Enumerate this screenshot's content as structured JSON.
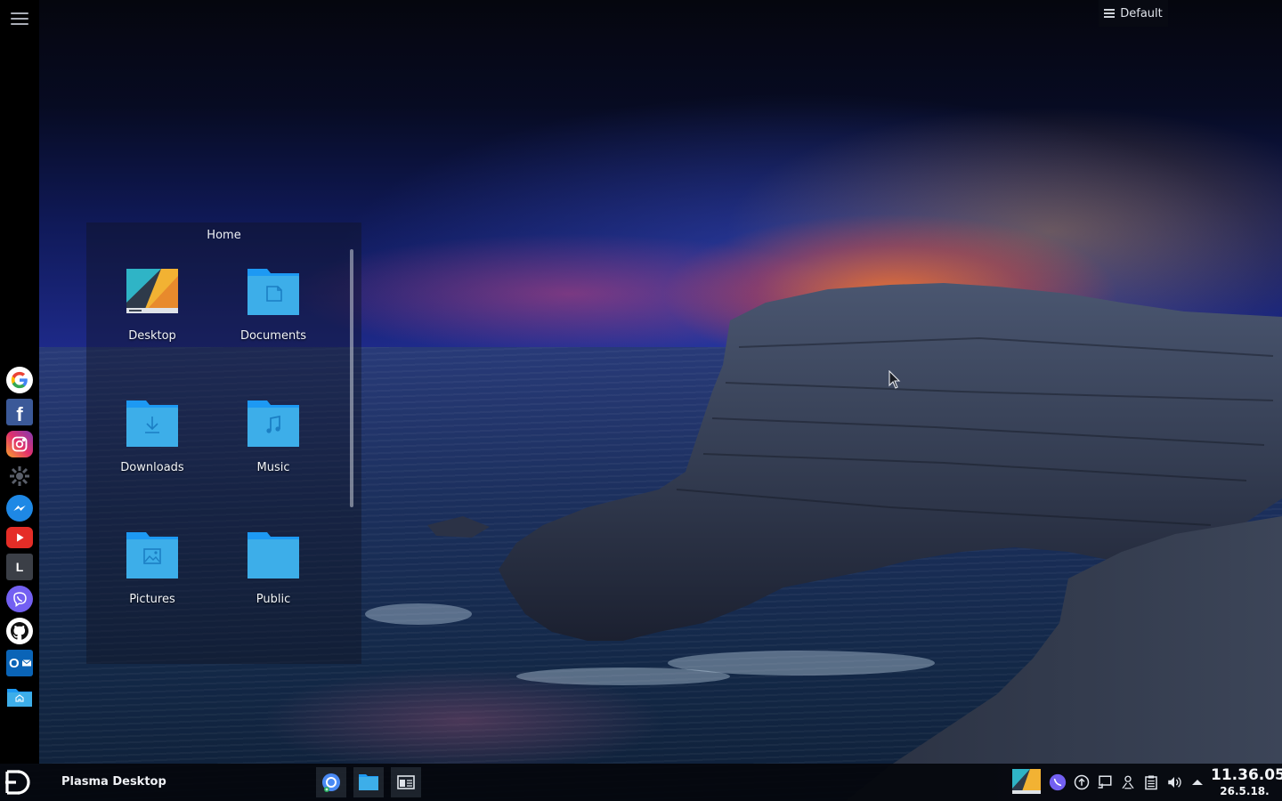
{
  "toolbox": {
    "label": "Default",
    "icon": "hamburger-icon"
  },
  "left_dock": {
    "menu_icon": "hamburger-menu-icon",
    "favorites": [
      {
        "name": "google",
        "glyph": "G"
      },
      {
        "name": "facebook",
        "glyph": "f"
      },
      {
        "name": "instagram",
        "glyph": ""
      },
      {
        "name": "kde",
        "glyph": ""
      },
      {
        "name": "messenger",
        "glyph": ""
      },
      {
        "name": "youtube",
        "glyph": ""
      },
      {
        "name": "l-app",
        "glyph": "L"
      },
      {
        "name": "viber",
        "glyph": ""
      },
      {
        "name": "github",
        "glyph": ""
      },
      {
        "name": "outlook",
        "glyph": "O"
      },
      {
        "name": "home-folder",
        "glyph": ""
      }
    ]
  },
  "folder_view": {
    "title": "Home",
    "items": [
      {
        "label": "Desktop",
        "icon": "desktop-folder-icon"
      },
      {
        "label": "Documents",
        "icon": "documents-folder-icon"
      },
      {
        "label": "Downloads",
        "icon": "downloads-folder-icon"
      },
      {
        "label": "Music",
        "icon": "music-folder-icon"
      },
      {
        "label": "Pictures",
        "icon": "pictures-folder-icon"
      },
      {
        "label": "Public",
        "icon": "public-folder-icon"
      }
    ]
  },
  "panel": {
    "active_window_title": "Plasma Desktop",
    "tasks": [
      {
        "name": "chromium",
        "active": true
      },
      {
        "name": "file-manager",
        "active": true
      },
      {
        "name": "window-list",
        "active": true
      }
    ],
    "tray": [
      "desktop-thumbnail",
      "viber",
      "update",
      "network",
      "kde-connect",
      "clipboard",
      "volume",
      "expand"
    ],
    "clock": {
      "time": "11.36.05",
      "date": "26.5.18."
    }
  },
  "colors": {
    "folder_blue": "#3daee9",
    "folder_blue_dark": "#1d99f3",
    "panel_bg": "#04060c"
  }
}
